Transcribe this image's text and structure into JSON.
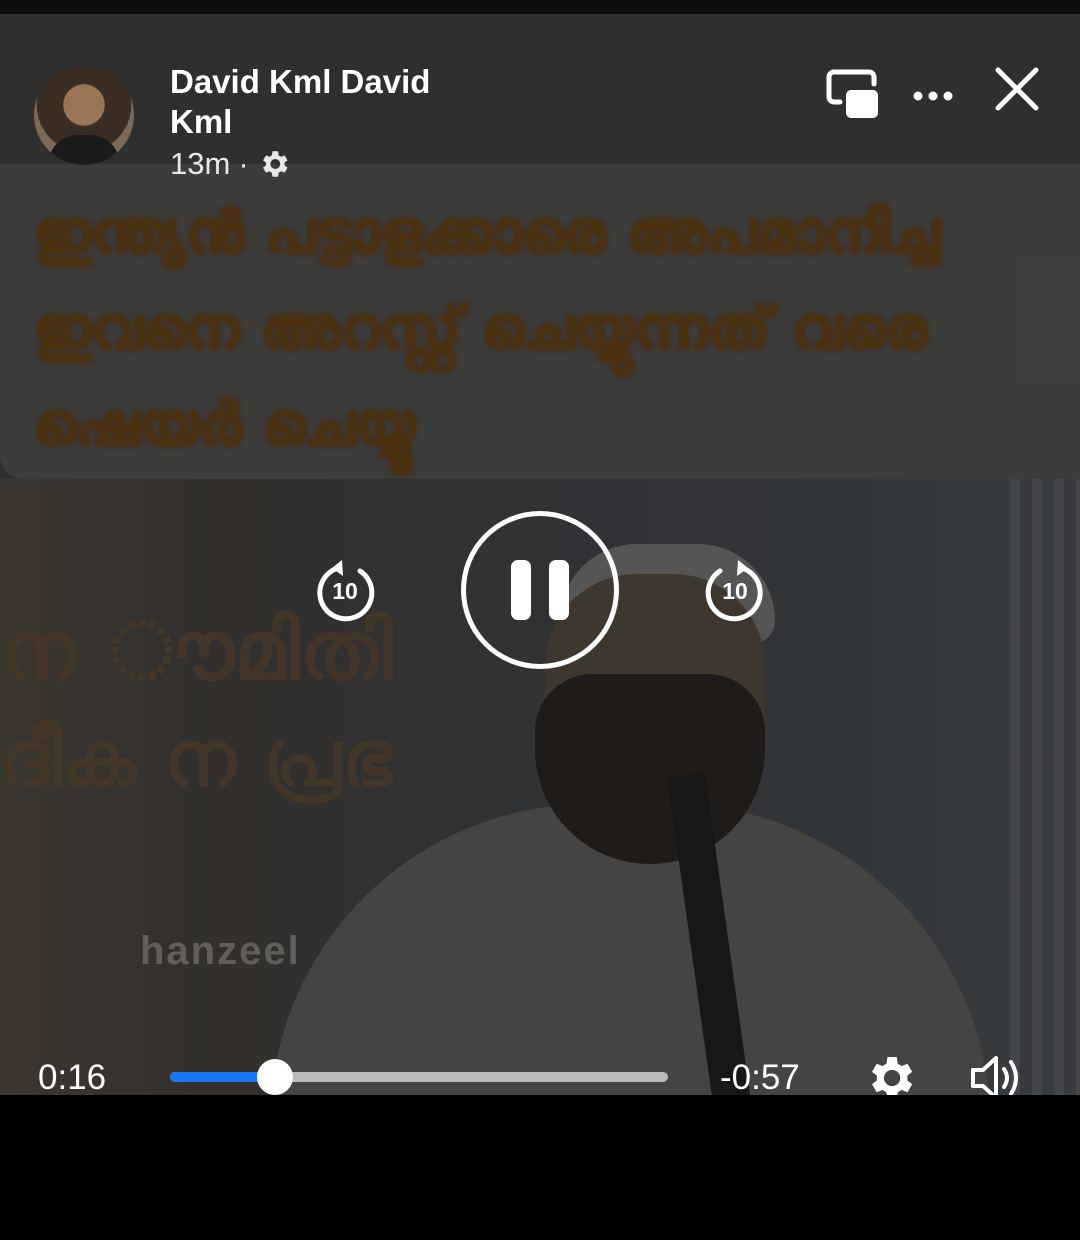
{
  "post": {
    "author_name": "David Kml David Kml",
    "timestamp": "13m",
    "separator": "·",
    "audience_icon": "gear-icon"
  },
  "top_controls": {
    "pip_icon": "picture-in-picture-icon",
    "more_icon": "more-options-icon",
    "close_icon": "close-icon"
  },
  "video": {
    "caption": "ഇന്ത്യൻ പട്ടാളക്കാരെ അപമാനിച്ച ഇവനെ അറസ്റ്റ് ചെയ്യുന്നത് വരെ ഷെയർ ചെയ്യൂ",
    "watermark": "hanzeel"
  },
  "playback": {
    "rewind_seconds": "10",
    "forward_seconds": "10",
    "state": "playing",
    "current_time": "0:16",
    "remaining_time": "-0:57",
    "progress": 0.21
  },
  "colors": {
    "progress_fill": "#1877f2",
    "track": "#b9b9b9",
    "caption": "#5b3d14"
  }
}
